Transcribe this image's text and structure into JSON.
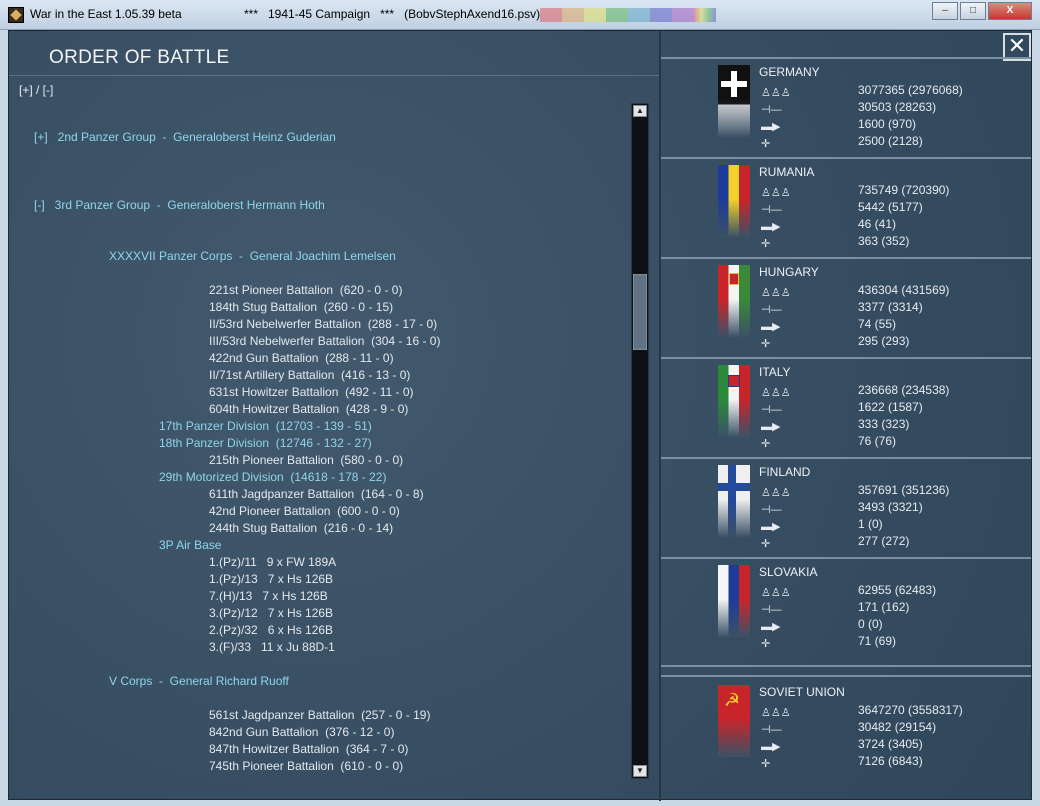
{
  "window": {
    "title": "War in the East 1.05.39 beta",
    "campaign": "***   1941-45 Campaign   ***   (BobvStephAxend16.psv)",
    "minimize": "–",
    "maximize": "□",
    "close": "X"
  },
  "panel": {
    "title": "ORDER OF BATTLE",
    "expand_toggle": "[+] / [-]",
    "close_label": "✕"
  },
  "oob_rows": [
    {
      "text": "[+]   2nd Panzer Group  -  Generaloberst Heinz Guderian",
      "indent": 0,
      "style": "cyan"
    },
    {
      "text": "[-]   3rd Panzer Group  -  Generaloberst Hermann Hoth",
      "indent": 0,
      "style": "cyan"
    },
    {
      "text": "XXXXVII Panzer Corps  -  General Joachim Lemelsen",
      "indent": 1,
      "style": "cyan"
    },
    {
      "text": "221st Pioneer Battalion  (620 - 0 - 0)",
      "indent": 3,
      "style": "white"
    },
    {
      "text": "184th Stug Battalion  (260 - 0 - 15)",
      "indent": 3,
      "style": "white"
    },
    {
      "text": "II/53rd Nebelwerfer Battalion  (288 - 17 - 0)",
      "indent": 3,
      "style": "white"
    },
    {
      "text": "III/53rd Nebelwerfer Battalion  (304 - 16 - 0)",
      "indent": 3,
      "style": "white"
    },
    {
      "text": "422nd Gun Battalion  (288 - 11 - 0)",
      "indent": 3,
      "style": "white"
    },
    {
      "text": "II/71st Artillery Battalion  (416 - 13 - 0)",
      "indent": 3,
      "style": "white"
    },
    {
      "text": "631st Howitzer Battalion  (492 - 11 - 0)",
      "indent": 3,
      "style": "white"
    },
    {
      "text": "604th Howitzer Battalion  (428 - 9 - 0)",
      "indent": 3,
      "style": "white"
    },
    {
      "text": "17th Panzer Division  (12703 - 139 - 51)",
      "indent": 2,
      "style": "cyan"
    },
    {
      "text": "18th Panzer Division  (12746 - 132 - 27)",
      "indent": 2,
      "style": "cyan"
    },
    {
      "text": "215th Pioneer Battalion  (580 - 0 - 0)",
      "indent": 3,
      "style": "white"
    },
    {
      "text": "29th Motorized Division  (14618 - 178 - 22)",
      "indent": 2,
      "style": "cyan"
    },
    {
      "text": "611th Jagdpanzer Battalion  (164 - 0 - 8)",
      "indent": 3,
      "style": "white"
    },
    {
      "text": "42nd Pioneer Battalion  (600 - 0 - 0)",
      "indent": 3,
      "style": "white"
    },
    {
      "text": "244th Stug Battalion  (216 - 0 - 14)",
      "indent": 3,
      "style": "white"
    },
    {
      "text": "3P Air Base",
      "indent": 2,
      "style": "cyan"
    },
    {
      "text": "1.(Pz)/11   9 x FW 189A",
      "indent": 3,
      "style": "white"
    },
    {
      "text": "1.(Pz)/13   7 x Hs 126B",
      "indent": 3,
      "style": "white"
    },
    {
      "text": "7.(H)/13   7 x Hs 126B",
      "indent": 3,
      "style": "white"
    },
    {
      "text": "3.(Pz)/12   7 x Hs 126B",
      "indent": 3,
      "style": "white"
    },
    {
      "text": "2.(Pz)/32   6 x Hs 126B",
      "indent": 3,
      "style": "white"
    },
    {
      "text": "3.(F)/33   11 x Ju 88D-1",
      "indent": 3,
      "style": "white"
    },
    {
      "text": "V Corps  -  General Richard Ruoff",
      "indent": 1,
      "style": "cyan"
    },
    {
      "text": "561st Jagdpanzer Battalion  (257 - 0 - 19)",
      "indent": 3,
      "style": "white"
    },
    {
      "text": "842nd Gun Battalion  (376 - 12 - 0)",
      "indent": 3,
      "style": "white"
    },
    {
      "text": "847th Howitzer Battalion  (364 - 7 - 0)",
      "indent": 3,
      "style": "white"
    },
    {
      "text": "745th Pioneer Battalion  (610 - 0 - 0)",
      "indent": 3,
      "style": "white"
    }
  ],
  "stat_icons": [
    "men-icon",
    "gun-icon",
    "tank-icon",
    "aircraft-icon"
  ],
  "nations": [
    {
      "name": "GERMANY",
      "flag": "germany-flag",
      "men": "3077365 (2976068)",
      "guns": "30503 (28263)",
      "afv": "1600 (970)",
      "aircraft": "2500 (2128)"
    },
    {
      "name": "RUMANIA",
      "flag": "rumania-flag",
      "men": "735749 (720390)",
      "guns": "5442 (5177)",
      "afv": "46 (41)",
      "aircraft": "363 (352)"
    },
    {
      "name": "HUNGARY",
      "flag": "hungary-flag",
      "men": "436304 (431569)",
      "guns": "3377 (3314)",
      "afv": "74 (55)",
      "aircraft": "295 (293)"
    },
    {
      "name": "ITALY",
      "flag": "italy-flag",
      "men": "236668 (234538)",
      "guns": "1622 (1587)",
      "afv": "333 (323)",
      "aircraft": "76 (76)"
    },
    {
      "name": "FINLAND",
      "flag": "finland-flag",
      "men": "357691 (351236)",
      "guns": "3493 (3321)",
      "afv": "1 (0)",
      "aircraft": "277 (272)"
    },
    {
      "name": "SLOVAKIA",
      "flag": "slovakia-flag",
      "men": "62955 (62483)",
      "guns": "171 (162)",
      "afv": "0 (0)",
      "aircraft": "71 (69)"
    },
    {
      "name": "SOVIET UNION",
      "flag": "soviet-flag",
      "men": "3647270 (3558317)",
      "guns": "30482 (29154)",
      "afv": "3724 (3405)",
      "aircraft": "7126 (6843)"
    }
  ]
}
